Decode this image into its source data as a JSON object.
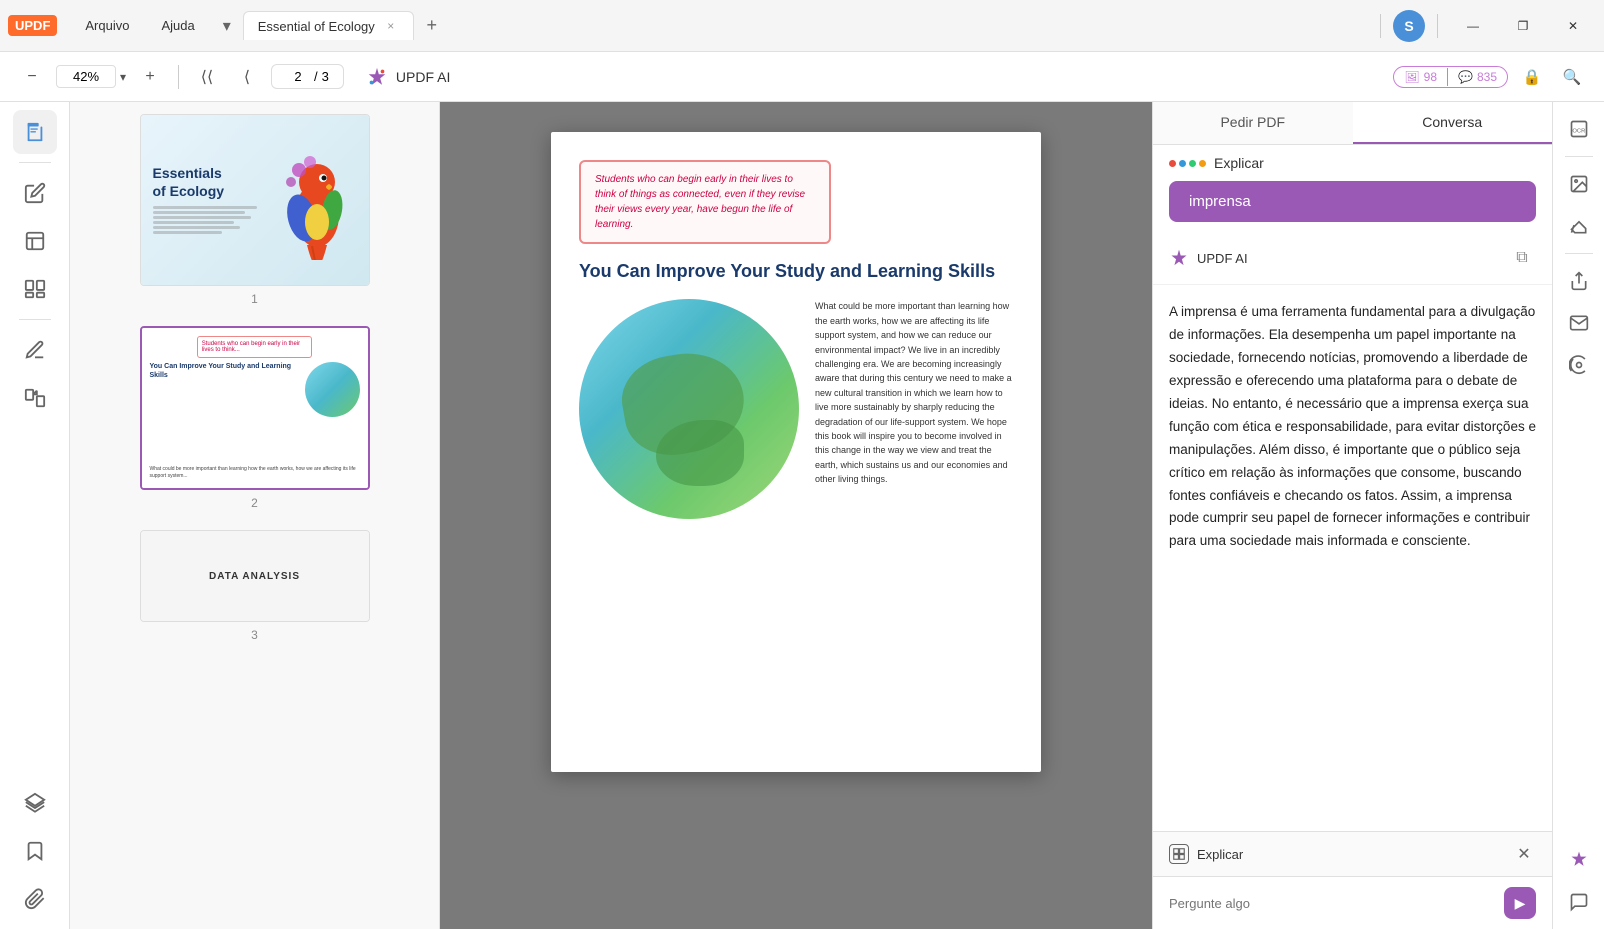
{
  "titlebar": {
    "logo": "UPDF",
    "menu_arquivo": "Arquivo",
    "menu_ajuda": "Ajuda",
    "tab_title": "Essential of Ecology",
    "tab_close": "×",
    "tab_add": "+",
    "user_initial": "S",
    "win_minimize": "—",
    "win_maximize": "❐",
    "win_close": "✕"
  },
  "toolbar": {
    "zoom_out": "−",
    "zoom_value": "42%",
    "zoom_in": "+",
    "nav_up_top": "⟨",
    "nav_up": "↑",
    "page_current": "2",
    "page_separator": "/",
    "page_total": "3",
    "ai_label": "UPDF AI",
    "badge_count1": "98",
    "badge_count2": "835",
    "lock_icon": "🔒",
    "search_icon": "🔍"
  },
  "left_sidebar": {
    "items": [
      {
        "name": "document-icon",
        "symbol": "📄"
      },
      {
        "name": "edit-icon",
        "symbol": "✏️"
      },
      {
        "name": "format-icon",
        "symbol": "📝"
      },
      {
        "name": "pages-icon",
        "symbol": "📑"
      },
      {
        "name": "annotate-icon",
        "symbol": "🖊️"
      },
      {
        "name": "convert-icon",
        "symbol": "🔄"
      },
      {
        "name": "layers-icon",
        "symbol": "⊞"
      },
      {
        "name": "bookmark-icon",
        "symbol": "🔖"
      },
      {
        "name": "attach-icon",
        "symbol": "📎"
      }
    ]
  },
  "thumbnails": [
    {
      "page_num": "1",
      "title_line1": "Essentials",
      "title_line2": "of Ecology",
      "active": false
    },
    {
      "page_num": "2",
      "heading": "You Can Improve Your Study and Learning Skills",
      "active": true
    },
    {
      "page_num": "3",
      "label": "DATA ANALYSIS",
      "active": false
    }
  ],
  "pdf_page": {
    "quote": "Students who can begin early in their lives to think of things as connected, even if they revise their views every year, have begun the life of learning.",
    "title": "You Can Improve Your Study and Learning Skills",
    "body_text": "What could be more important than learning how the earth works, how we are affecting its life support system, and how we can reduce our environmental impact? We live in an incredibly challenging era. We are becoming increasingly aware that during this century we need to make a new cultural transition in which we learn how to live more sustainably by sharply reducing the degradation of our life-support system. We hope this book will inspire you to become involved in this change in the way we view and treat the earth, which sustains us and our economies and other living things."
  },
  "ai_panel": {
    "tab_pedir": "Pedir PDF",
    "tab_conversa": "Conversa",
    "header_label": "UPDF AI",
    "explain_label": "Explicar",
    "button_imprensa": "imprensa",
    "message": "A imprensa é uma ferramenta fundamental para a divulgação de informações. Ela desempenha um papel importante na sociedade, fornecendo notícias, promovendo a liberdade de expressão e oferecendo uma plataforma para o debate de ideias. No entanto, é necessário que a imprensa exerça sua função com ética e responsabilidade, para evitar distorções e manipulações. Além disso, é importante que o público seja crítico em relação às informações que consome, buscando fontes confiáveis e checando os fatos. Assim, a imprensa pode cumprir seu papel de fornecer informações e contribuir para uma sociedade mais informada e consciente.",
    "footer_explain_label": "Explicar",
    "input_placeholder": "Pergunte algo",
    "send_icon": "▶"
  },
  "right_toolbar": {
    "items": [
      {
        "name": "ocr-icon",
        "symbol": "OCR"
      },
      {
        "name": "image-icon",
        "symbol": "🖼"
      },
      {
        "name": "sign-icon",
        "symbol": "✍"
      },
      {
        "name": "stamp-icon",
        "symbol": "⊙"
      },
      {
        "name": "redact-icon",
        "symbol": "⬛"
      },
      {
        "name": "share-icon",
        "symbol": "↑"
      },
      {
        "name": "email-icon",
        "symbol": "✉"
      },
      {
        "name": "save-icon",
        "symbol": "💾"
      },
      {
        "name": "ai-icon",
        "symbol": "✦"
      },
      {
        "name": "chat-icon",
        "symbol": "💬"
      }
    ]
  }
}
